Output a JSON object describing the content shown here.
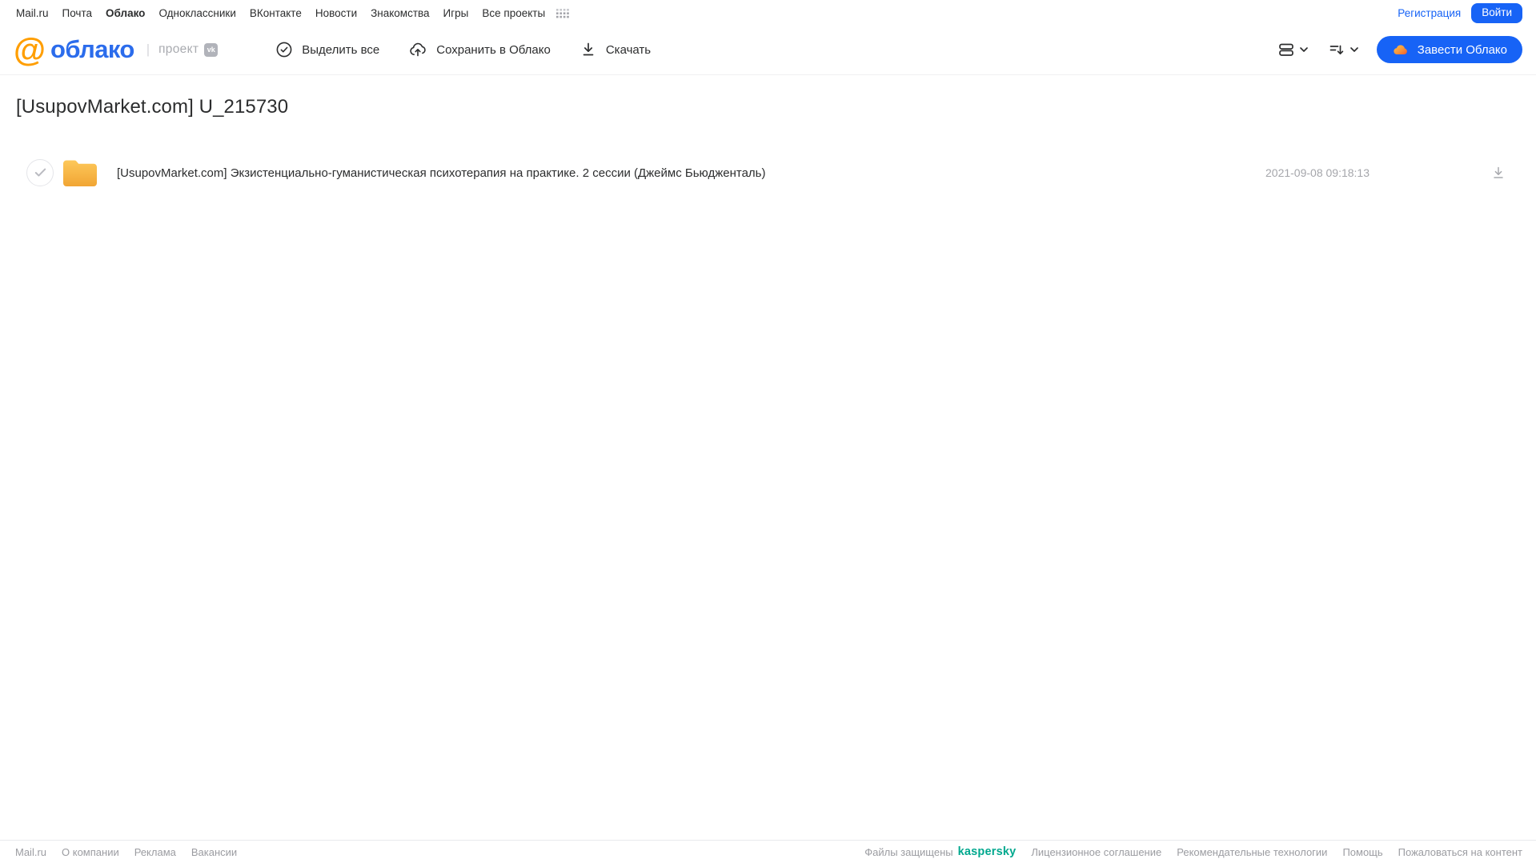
{
  "topnav": {
    "items": [
      {
        "label": "Mail.ru"
      },
      {
        "label": "Почта"
      },
      {
        "label": "Облако"
      },
      {
        "label": "Одноклассники"
      },
      {
        "label": "ВКонтакте"
      },
      {
        "label": "Новости"
      },
      {
        "label": "Знакомства"
      },
      {
        "label": "Игры"
      },
      {
        "label": "Все проекты"
      }
    ],
    "registration_label": "Регистрация",
    "login_label": "Войти"
  },
  "logo": {
    "at": "@",
    "product": "облако",
    "divider": "|",
    "project_label": "проект",
    "vk_label": "vk"
  },
  "toolbar": {
    "actions": [
      {
        "label": "Выделить все",
        "icon": "check-circle-icon"
      },
      {
        "label": "Сохранить в Облако",
        "icon": "cloud-upload-icon"
      },
      {
        "label": "Скачать",
        "icon": "download-icon"
      }
    ],
    "view_menu_icon": "list-view-icon",
    "sort_menu_icon": "sort-icon",
    "cta_label": "Завести Облако"
  },
  "main": {
    "title": "[UsupovMarket.com] U_215730",
    "files": [
      {
        "type": "folder",
        "name": "[UsupovMarket.com] Экзистенциально-гуманистическая психотерапия на практике. 2 сессии (Джеймс Бьюдженталь)",
        "date": "2021-09-08 09:18:13"
      }
    ]
  },
  "footer": {
    "left_links": [
      {
        "label": "Mail.ru"
      },
      {
        "label": "О компании"
      },
      {
        "label": "Реклама"
      },
      {
        "label": "Вакансии"
      }
    ],
    "protected_label": "Файлы защищены",
    "kaspersky_label": "kaspersky",
    "right_links": [
      {
        "label": "Лицензионное соглашение"
      },
      {
        "label": "Рекомендательные технологии"
      },
      {
        "label": "Помощь"
      },
      {
        "label": "Пожаловаться на контент"
      }
    ]
  },
  "colors": {
    "accent_blue": "#1763f6",
    "logo_orange": "#ff9e00",
    "logo_blue": "#2b6cec",
    "folder_yellow": "#f5ae3d",
    "kaspersky_green": "#00a88e",
    "muted_gray": "#9b9ca1",
    "date_gray": "#a5a6ab"
  }
}
